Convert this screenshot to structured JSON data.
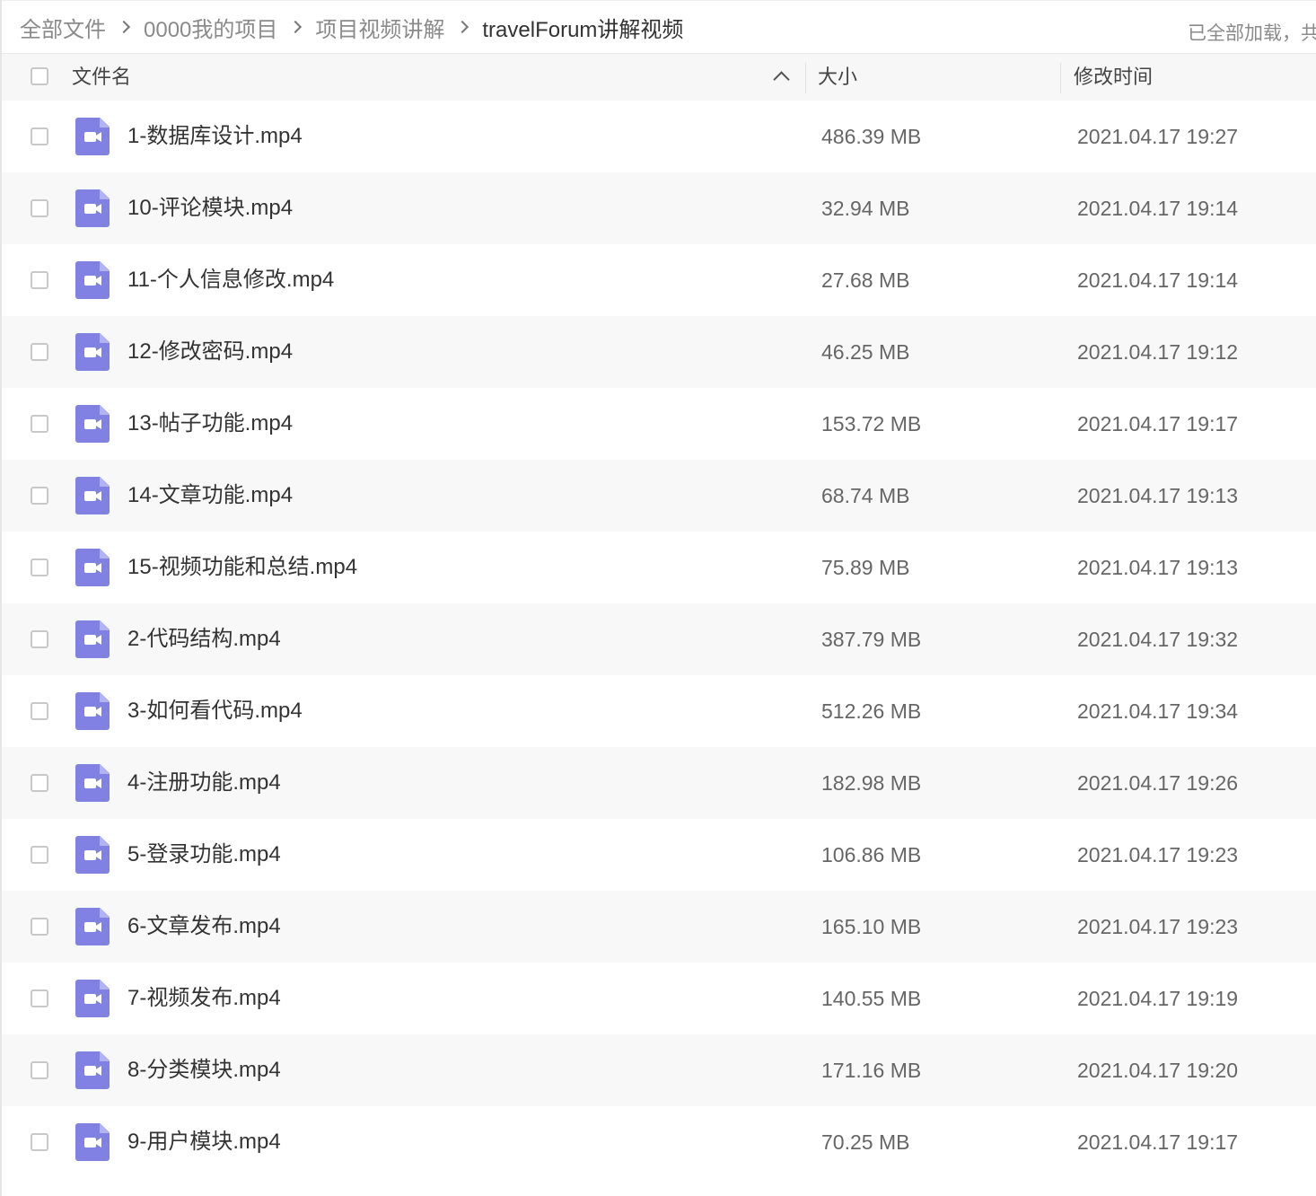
{
  "breadcrumb": {
    "items": [
      "全部文件",
      "0000我的项目",
      "项目视频讲解"
    ],
    "current": "travelForum讲解视频",
    "load_status": "已全部加载，共"
  },
  "table_header": {
    "name": "文件名",
    "size": "大小",
    "modified": "修改时间",
    "sort": "ascending"
  },
  "files": [
    {
      "name": "1-数据库设计.mp4",
      "size": "486.39 MB",
      "modified": "2021.04.17 19:27"
    },
    {
      "name": "10-评论模块.mp4",
      "size": "32.94 MB",
      "modified": "2021.04.17 19:14"
    },
    {
      "name": "11-个人信息修改.mp4",
      "size": "27.68 MB",
      "modified": "2021.04.17 19:14"
    },
    {
      "name": "12-修改密码.mp4",
      "size": "46.25 MB",
      "modified": "2021.04.17 19:12"
    },
    {
      "name": "13-帖子功能.mp4",
      "size": "153.72 MB",
      "modified": "2021.04.17 19:17"
    },
    {
      "name": "14-文章功能.mp4",
      "size": "68.74 MB",
      "modified": "2021.04.17 19:13"
    },
    {
      "name": "15-视频功能和总结.mp4",
      "size": "75.89 MB",
      "modified": "2021.04.17 19:13"
    },
    {
      "name": "2-代码结构.mp4",
      "size": "387.79 MB",
      "modified": "2021.04.17 19:32"
    },
    {
      "name": "3-如何看代码.mp4",
      "size": "512.26 MB",
      "modified": "2021.04.17 19:34"
    },
    {
      "name": "4-注册功能.mp4",
      "size": "182.98 MB",
      "modified": "2021.04.17 19:26"
    },
    {
      "name": "5-登录功能.mp4",
      "size": "106.86 MB",
      "modified": "2021.04.17 19:23"
    },
    {
      "name": "6-文章发布.mp4",
      "size": "165.10 MB",
      "modified": "2021.04.17 19:23"
    },
    {
      "name": "7-视频发布.mp4",
      "size": "140.55 MB",
      "modified": "2021.04.17 19:19"
    },
    {
      "name": "8-分类模块.mp4",
      "size": "171.16 MB",
      "modified": "2021.04.17 19:20"
    },
    {
      "name": "9-用户模块.mp4",
      "size": "70.25 MB",
      "modified": "2021.04.17 19:17"
    }
  ],
  "icons": {
    "file": "video-file-icon",
    "sort": "chevron-up-icon",
    "separator": "chevron-right-icon"
  },
  "colors": {
    "video_icon": "#8081e2",
    "row_alt": "#f8f8f9",
    "header_bg": "#f7f7f8"
  }
}
